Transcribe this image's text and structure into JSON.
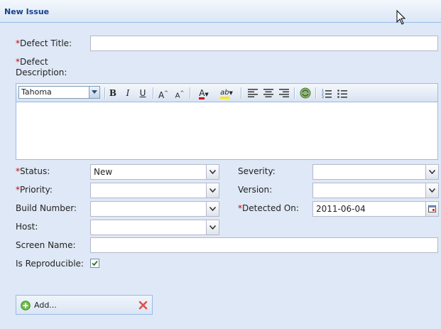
{
  "header": {
    "title": "New Issue"
  },
  "form": {
    "defect_title": {
      "label": "Defect Title:",
      "required_mark": "*",
      "value": ""
    },
    "defect_description": {
      "label_line1": "Defect",
      "label_line2": "Description:",
      "required_mark": "*"
    },
    "editor": {
      "font": "Tahoma",
      "body": ""
    },
    "status": {
      "label": "Status:",
      "required_mark": "*",
      "value": "New"
    },
    "severity": {
      "label": "Severity:",
      "value": ""
    },
    "priority": {
      "label": "Priority:",
      "required_mark": "*",
      "value": ""
    },
    "version": {
      "label": "Version:",
      "value": ""
    },
    "build_number": {
      "label": "Build Number:",
      "value": ""
    },
    "detected_on": {
      "label": "Detected On:",
      "required_mark": "*",
      "value": "2011-06-04"
    },
    "host": {
      "label": "Host:",
      "value": ""
    },
    "screen_name": {
      "label": "Screen Name:",
      "value": ""
    },
    "is_reproducible": {
      "label": "Is Reproducible:",
      "checked": true
    }
  },
  "attachments": {
    "add_label": "Add..."
  },
  "colors": {
    "required": "#cc0000",
    "panel_bg": "#dfe8f6",
    "header_text": "#15428b",
    "border": "#99bbe8"
  },
  "icons": {
    "bold": "B",
    "italic": "I",
    "underline": "U",
    "grow": "A",
    "shrink": "A",
    "font_color": "A",
    "highlight": "ab"
  }
}
